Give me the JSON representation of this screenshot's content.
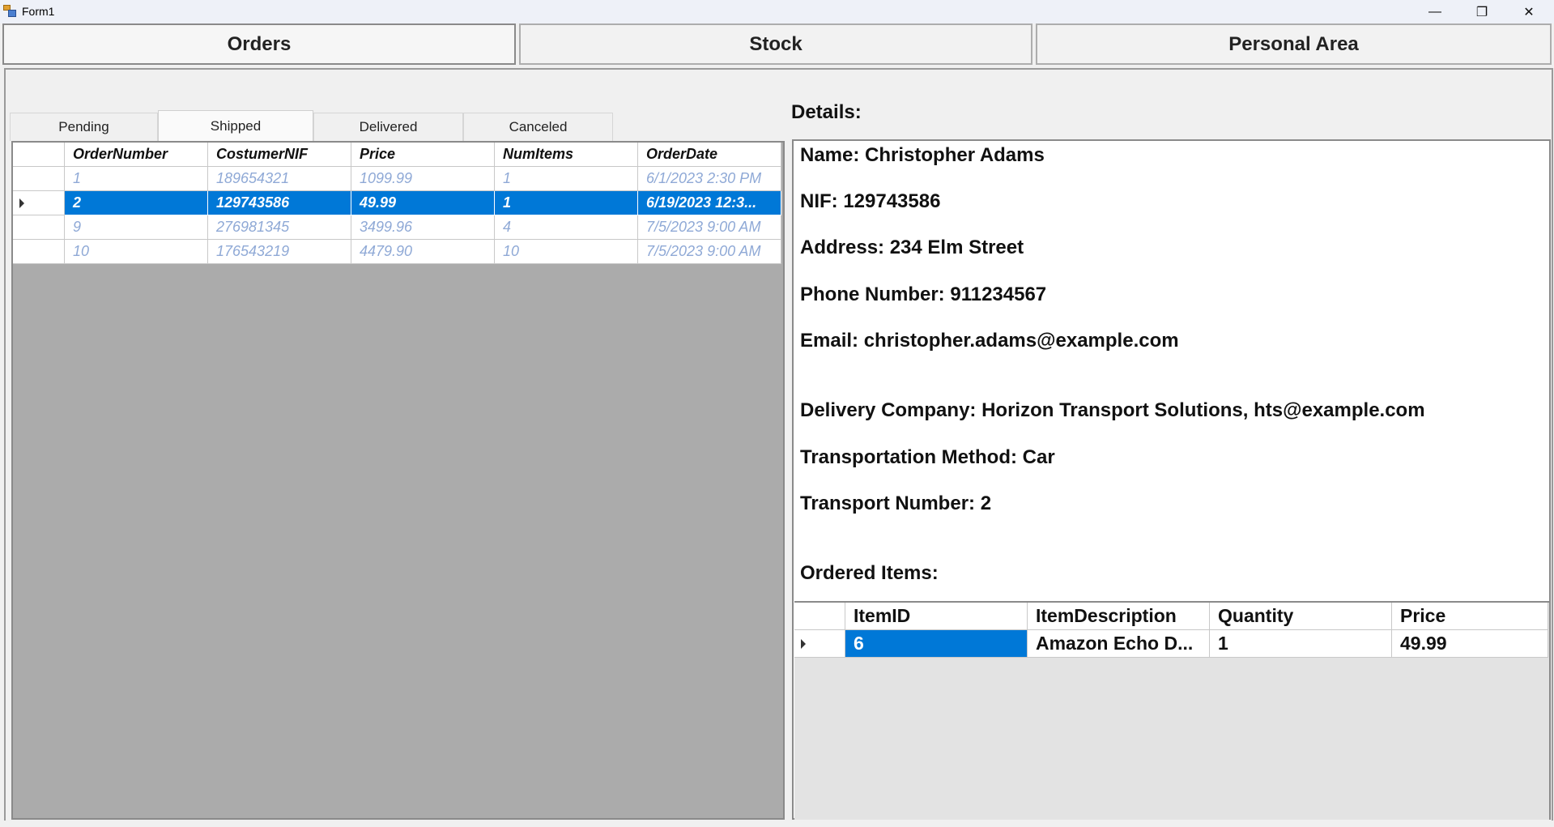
{
  "window": {
    "title": "Form1",
    "minimize": "—",
    "restore": "❐",
    "close": "✕"
  },
  "nav": {
    "orders": "Orders",
    "stock": "Stock",
    "personal": "Personal Area"
  },
  "tabs": [
    "Pending",
    "Shipped",
    "Delivered",
    "Canceled"
  ],
  "active_tab": "Shipped",
  "orders_grid": {
    "columns": [
      "OrderNumber",
      "CostumerNIF",
      "Price",
      "NumItems",
      "OrderDate"
    ],
    "rows": [
      [
        "1",
        "189654321",
        "1099.99",
        "1",
        "6/1/2023 2:30 PM"
      ],
      [
        "2",
        "129743586",
        "49.99",
        "1",
        "6/19/2023 12:3..."
      ],
      [
        "9",
        "276981345",
        "3499.96",
        "4",
        "7/5/2023 9:00 AM"
      ],
      [
        "10",
        "176543219",
        "4479.90",
        "10",
        "7/5/2023 9:00 AM"
      ]
    ],
    "selected_row": 1
  },
  "details": {
    "label": "Details:",
    "name": "Name: Christopher Adams",
    "nif": "NIF: 129743586",
    "address": "Address: 234 Elm Street",
    "phone": "Phone Number: 911234567",
    "email": "Email: christopher.adams@example.com",
    "delivery": "Delivery Company: Horizon Transport Solutions, hts@example.com",
    "method": "Transportation Method: Car",
    "transport_number": "Transport Number: 2",
    "ordered_items_label": "Ordered Items:"
  },
  "items_grid": {
    "columns": [
      "ItemID",
      "ItemDescription",
      "Quantity",
      "Price"
    ],
    "rows": [
      [
        "6",
        "Amazon Echo D...",
        "1",
        "49.99"
      ]
    ]
  },
  "colors": {
    "selection": "#0078d7",
    "grid_bg": "#ababab",
    "unselected_text": "#8fa9d6"
  }
}
